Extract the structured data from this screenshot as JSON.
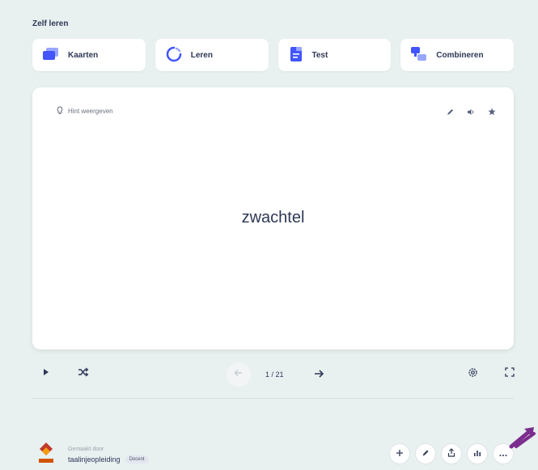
{
  "section": {
    "title": "Zelf leren"
  },
  "modes": [
    {
      "label": "Kaarten",
      "icon": "cards-icon"
    },
    {
      "label": "Leren",
      "icon": "learn-cycle-icon"
    },
    {
      "label": "Test",
      "icon": "test-document-icon"
    },
    {
      "label": "Combineren",
      "icon": "match-icon"
    }
  ],
  "card": {
    "hint": "Hint weergeven",
    "term": "zwachtel"
  },
  "navigation": {
    "counter": "1 / 21"
  },
  "creator": {
    "created_by": "Gemaakt door",
    "name": "taalinjeopleiding",
    "badge": "Docent"
  },
  "colors": {
    "background": "#e8f0f0",
    "accent": "#4255ff",
    "text": "#2e3856",
    "pointer": "#7b2d8e"
  }
}
